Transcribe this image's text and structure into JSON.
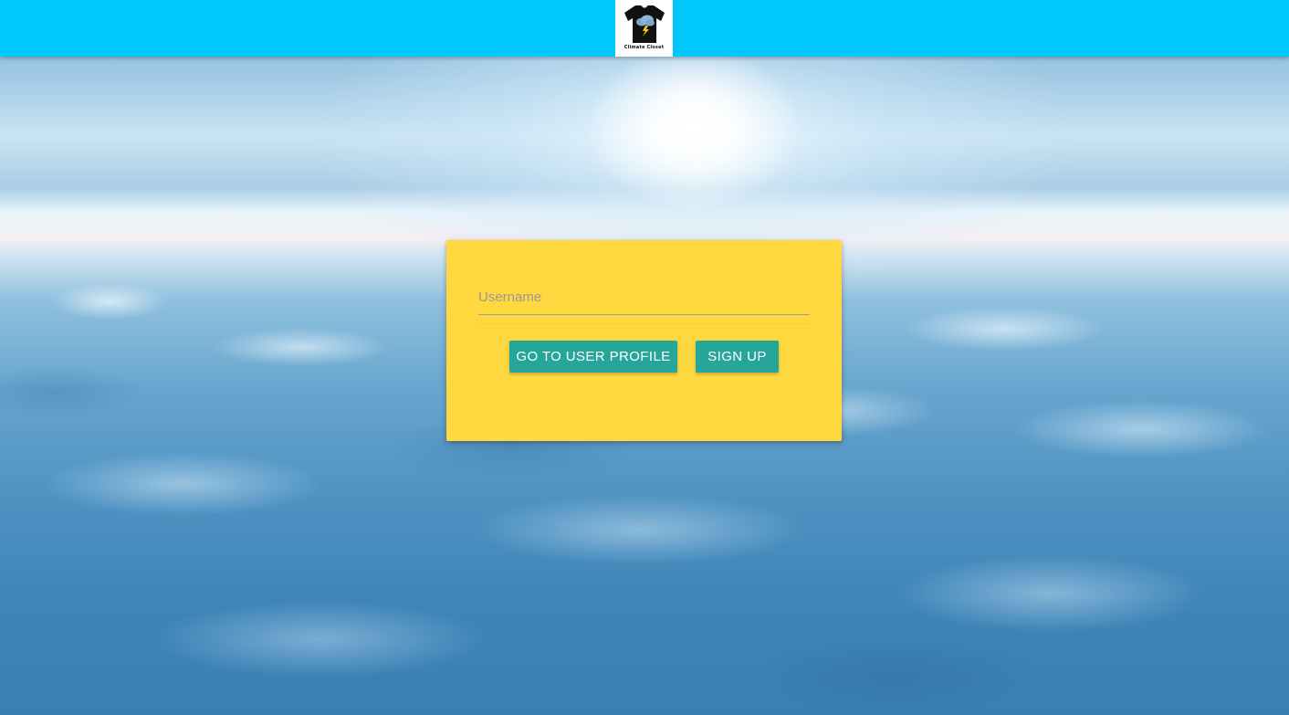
{
  "header": {
    "background_color": "#00c8fc",
    "logo": {
      "icon": "tshirt-storm-cloud-icon",
      "text": "Climate Closet"
    }
  },
  "login_card": {
    "background_color": "#fed83e",
    "username": {
      "placeholder": "Username",
      "value": ""
    },
    "buttons": {
      "profile_label": "GO TO USER PROFILE",
      "signup_label": "SIGN UP",
      "color": "#26a69a"
    }
  },
  "background": {
    "image": "sky-above-clouds"
  }
}
